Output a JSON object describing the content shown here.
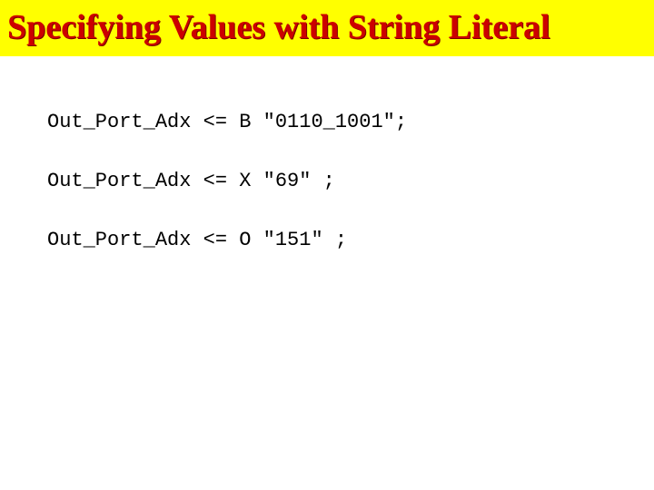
{
  "title": "Specifying Values with String Literal",
  "code_lines": [
    "Out_Port_Adx <= B \"0110_1001\";",
    "Out_Port_Adx <= X \"69\" ;",
    "Out_Port_Adx <= O \"151\" ;"
  ]
}
